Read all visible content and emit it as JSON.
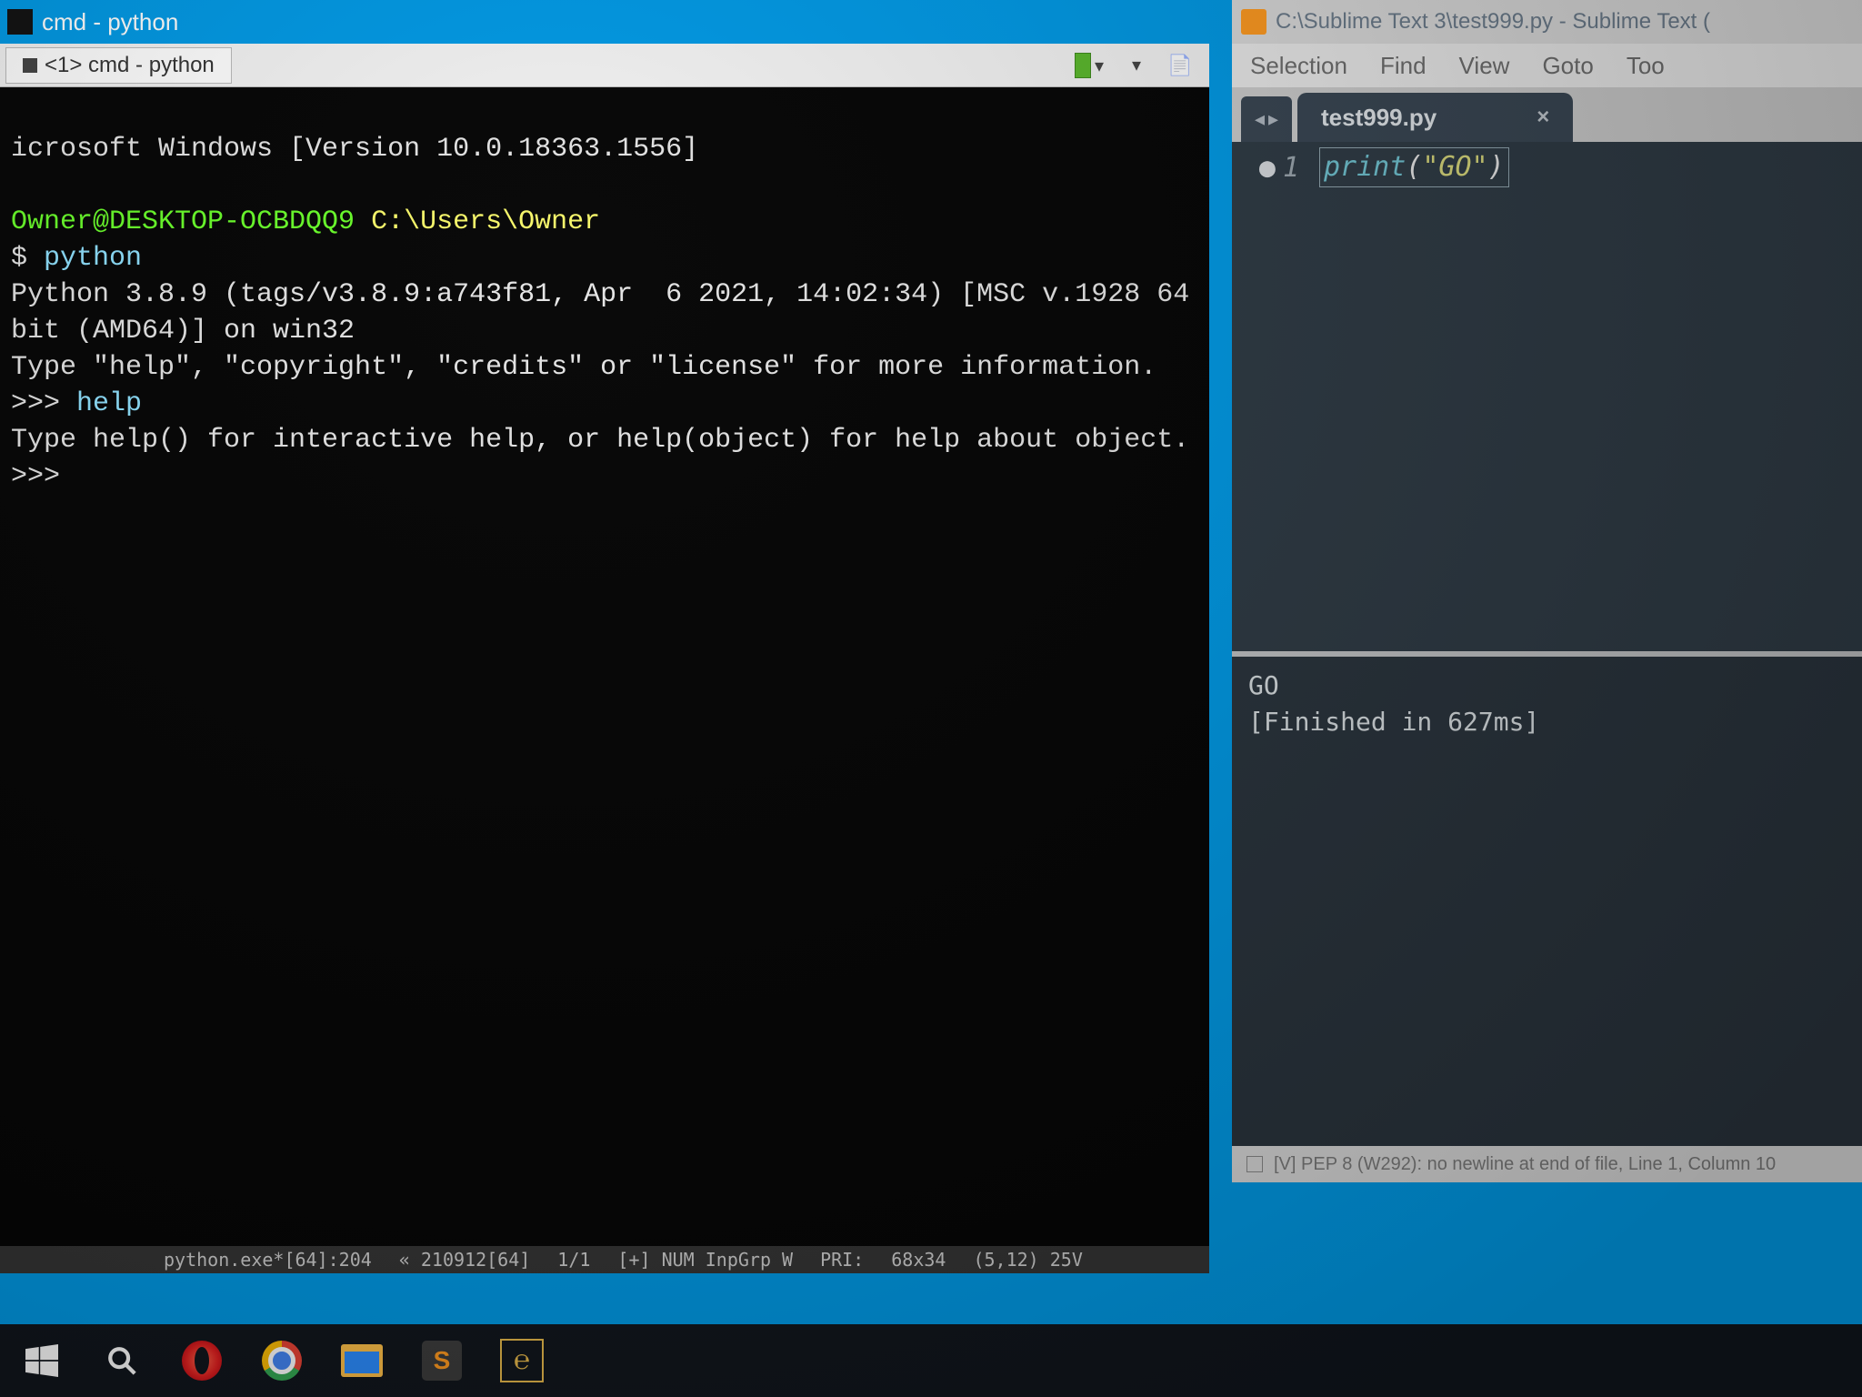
{
  "cmd": {
    "title": "cmd - python",
    "tab_label": "<1> cmd - python",
    "version_line": "icrosoft Windows [Version 10.0.18363.1556]",
    "userhost": "Owner@DESKTOP-OCBDQQ9",
    "cwd": "C:\\Users\\Owner",
    "dollar": "$",
    "python_cmd": "python",
    "py_version": "Python 3.8.9 (tags/v3.8.9:a743f81, Apr  6 2021, 14:02:34) [MSC v.1928 64 bit (AMD64)] on win32",
    "py_hint": "Type \"help\", \"copyright\", \"credits\" or \"license\" for more information.",
    "repl1": ">>> ",
    "help_cmd": "help",
    "help_resp": "Type help() for interactive help, or help(object) for help about object.",
    "repl2": ">>> ",
    "status": {
      "proc": "python.exe*[64]:204",
      "enc": "« 210912[64]",
      "pos": "1/1",
      "flags": "[+] NUM InpGrp W",
      "pri": "PRI:",
      "size": "68x34",
      "cursor": "(5,12) 25V"
    }
  },
  "sublime": {
    "title": "C:\\Sublime Text 3\\test999.py - Sublime Text (",
    "menu": [
      "Selection",
      "Find",
      "View",
      "Goto",
      "Too"
    ],
    "tab": "test999.py",
    "line_no": "1",
    "code_fn": "print",
    "code_open": "(",
    "code_str": "\"GO\"",
    "code_close": ")",
    "output_line1": "GO",
    "output_line2": "[Finished in 627ms]",
    "status": "[V] PEP 8 (W292): no newline at end of file, Line 1, Column 10"
  },
  "taskbar": {
    "items": [
      "start",
      "search",
      "opera",
      "chrome",
      "explorer",
      "sublime",
      "custom"
    ]
  }
}
